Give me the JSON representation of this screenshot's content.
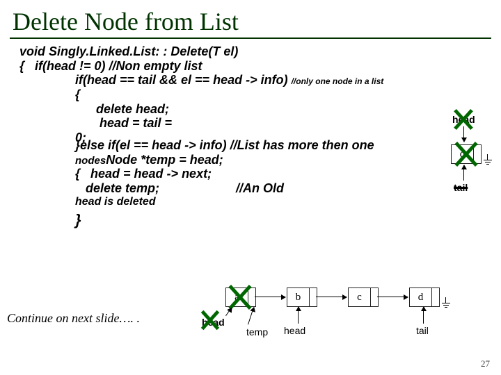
{
  "title": "Delete Node from List",
  "code": {
    "l1": "void Singly.Linked.List: : Delete(T el)",
    "l2a": "{   if(head != 0) ",
    "l2b": "//Non empty list",
    "l3a": "if(head == tail && el == head -> info) ",
    "l3b": "//only one node in a list",
    "l4": "{",
    "l5": "delete head;",
    "l6": " head = tail = ",
    "l7a": "0;",
    "l7b": "}",
    "l8a": "else if(el == head -> info) ",
    "l8b": "//List has more then one ",
    "l9a": "nodes",
    "l9b": "Node *temp = head;",
    "l10a": "{",
    "l10b": "   head = head -> next;",
    "l11a": "   delete temp;",
    "l11b": "//An Old ",
    "l12": "head is deleted",
    "l13": "}"
  },
  "continue": "Continue on next slide…. .",
  "slide_number": "27",
  "diagram1": {
    "head": "head",
    "tail": "tail",
    "val": "d"
  },
  "diagram2": {
    "a": "a",
    "b": "b",
    "c": "c",
    "d": "d",
    "head": "head",
    "temp": "temp",
    "tail": "tail"
  }
}
